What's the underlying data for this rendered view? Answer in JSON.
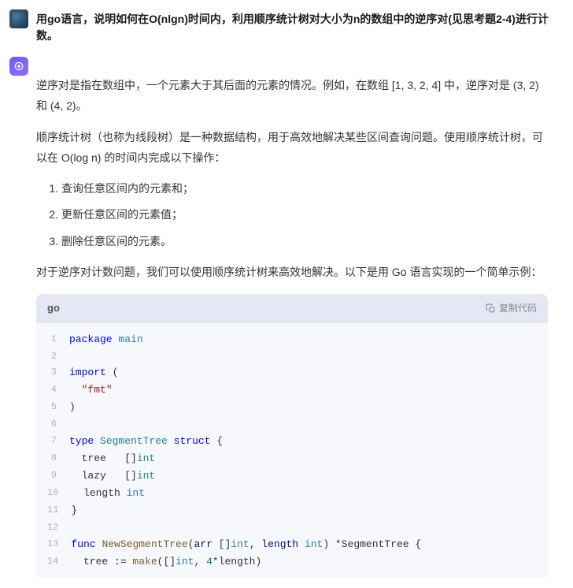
{
  "question": "用go语言，说明如何在O(nlgn)时间内，利用顺序统计树对大小为n的数组中的逆序对(见思考题2-4)进行计数。",
  "answer": {
    "para1": "逆序对是指在数组中，一个元素大于其后面的元素的情况。例如，在数组 [1, 3, 2, 4] 中，逆序对是 (3, 2) 和 (4, 2)。",
    "para2": "顺序统计树（也称为线段树）是一种数据结构，用于高效地解决某些区间查询问题。使用顺序统计树，可以在 O(log n) 的时间内完成以下操作：",
    "list": [
      "查询任意区间内的元素和；",
      "更新任意区间的元素值；",
      "删除任意区间的元素。"
    ],
    "para3": "对于逆序对计数问题，我们可以使用顺序统计树来高效地解决。以下是用 Go 语言实现的一个简单示例："
  },
  "code": {
    "lang": "go",
    "copy_label": "复制代码",
    "lines": [
      {
        "n": "1",
        "tokens": [
          {
            "c": "tok-kw",
            "t": "package"
          },
          {
            "c": "",
            "t": " "
          },
          {
            "c": "tok-pkg",
            "t": "main"
          }
        ]
      },
      {
        "n": "2",
        "tokens": []
      },
      {
        "n": "3",
        "tokens": [
          {
            "c": "tok-kw",
            "t": "import"
          },
          {
            "c": "",
            "t": " ("
          }
        ]
      },
      {
        "n": "4",
        "tokens": [
          {
            "c": "",
            "t": "  "
          },
          {
            "c": "tok-str",
            "t": "\"fmt\""
          }
        ]
      },
      {
        "n": "5",
        "tokens": [
          {
            "c": "",
            "t": ")"
          }
        ]
      },
      {
        "n": "6",
        "tokens": []
      },
      {
        "n": "7",
        "tokens": [
          {
            "c": "tok-kw",
            "t": "type"
          },
          {
            "c": "",
            "t": " "
          },
          {
            "c": "tok-deftype",
            "t": "SegmentTree"
          },
          {
            "c": "",
            "t": " "
          },
          {
            "c": "tok-kw",
            "t": "struct"
          },
          {
            "c": "",
            "t": " {"
          }
        ]
      },
      {
        "n": "8",
        "tokens": [
          {
            "c": "",
            "t": "  tree   []"
          },
          {
            "c": "tok-type",
            "t": "int"
          }
        ]
      },
      {
        "n": "9",
        "tokens": [
          {
            "c": "",
            "t": "  lazy   []"
          },
          {
            "c": "tok-type",
            "t": "int"
          }
        ]
      },
      {
        "n": "10",
        "tokens": [
          {
            "c": "",
            "t": "  length "
          },
          {
            "c": "tok-type",
            "t": "int"
          }
        ]
      },
      {
        "n": "11",
        "tokens": [
          {
            "c": "",
            "t": "}"
          }
        ]
      },
      {
        "n": "12",
        "tokens": []
      },
      {
        "n": "13",
        "tokens": [
          {
            "c": "tok-kw",
            "t": "func"
          },
          {
            "c": "",
            "t": " "
          },
          {
            "c": "tok-func",
            "t": "NewSegmentTree"
          },
          {
            "c": "",
            "t": "("
          },
          {
            "c": "tok-ident",
            "t": "arr"
          },
          {
            "c": "",
            "t": " []"
          },
          {
            "c": "tok-type",
            "t": "int"
          },
          {
            "c": "",
            "t": ", "
          },
          {
            "c": "tok-ident",
            "t": "length"
          },
          {
            "c": "",
            "t": " "
          },
          {
            "c": "tok-type",
            "t": "int"
          },
          {
            "c": "",
            "t": ") *SegmentTree {"
          }
        ]
      },
      {
        "n": "14",
        "tokens": [
          {
            "c": "",
            "t": "  tree := "
          },
          {
            "c": "tok-func",
            "t": "make"
          },
          {
            "c": "",
            "t": "([]"
          },
          {
            "c": "tok-type",
            "t": "int"
          },
          {
            "c": "",
            "t": ", "
          },
          {
            "c": "tok-num",
            "t": "4"
          },
          {
            "c": "",
            "t": "*length)"
          }
        ]
      }
    ]
  }
}
